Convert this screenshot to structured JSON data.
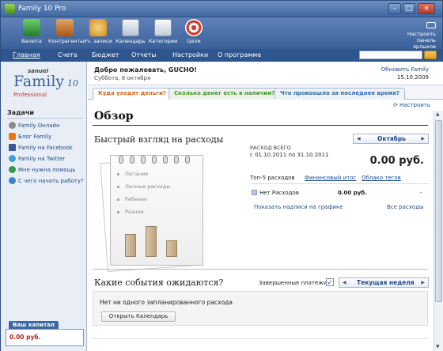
{
  "window": {
    "title": "Family 10 Pro"
  },
  "toolbar": {
    "items": [
      {
        "label": "Валюта",
        "icon": "currency-icon",
        "color": "#2e8b3a"
      },
      {
        "label": "Контрагенты",
        "icon": "contacts-bag-icon",
        "color": "#c47a2a"
      },
      {
        "label": "Уч. записи",
        "icon": "accounts-people-icon",
        "color": "#e0a030"
      },
      {
        "label": "Календарь",
        "icon": "calendar-icon",
        "color": "#cfd8e6"
      },
      {
        "label": "Категории",
        "icon": "categories-icon",
        "color": "#d9dfe8"
      },
      {
        "label": "Цели",
        "icon": "goals-target-icon",
        "color": "#d33b2c"
      }
    ],
    "customize": "Настроить панель ярлыков"
  },
  "menu": {
    "items": [
      "Главная",
      "Счета",
      "Бюджет",
      "Отчеты",
      "Настройки",
      "О программе"
    ],
    "active": "Главная"
  },
  "sidebar": {
    "logo": {
      "brand": "sanuel",
      "name": "Family",
      "version": "10",
      "edition": "Professional"
    },
    "tasks_title": "Задачи",
    "tasks": [
      {
        "label": "Family Онлайн",
        "icon": "globe-icon",
        "color": "#8a8a8a"
      },
      {
        "label": "Блог Family",
        "icon": "blog-icon",
        "color": "#e07820"
      },
      {
        "label": "Family на Facebook",
        "icon": "facebook-icon",
        "color": "#3b5998"
      },
      {
        "label": "Family на Twitter",
        "icon": "twitter-icon",
        "color": "#3aa0d8"
      },
      {
        "label": "Мне нужна помощь",
        "icon": "help-icon",
        "color": "#2e9a4a"
      },
      {
        "label": "С чего начать работу?",
        "icon": "info-icon",
        "color": "#3a86c8"
      }
    ],
    "capital": {
      "title": "Ваш капитал",
      "value": "0.00 руб."
    }
  },
  "greeting": {
    "hello": "Добро пожаловать, GUCHO!",
    "date": "Суббота, 8 октября",
    "update_link": "Обновить Family",
    "update_date": "15.10.2009"
  },
  "tabs": [
    {
      "label": "Куда уходят деньги?",
      "color": "#d8651a"
    },
    {
      "label": "Сколько денег есть в наличии?",
      "color": "#3a9a2a"
    },
    {
      "label": "Что произошло за последнее время?",
      "color": "#2a6cb0"
    }
  ],
  "content": {
    "settings_link": "Настроить",
    "overview_title": "Обзор",
    "quick_title": "Быстрый взгляд на расходы",
    "notepad": {
      "lines": [
        "Питание",
        "Личные расходы",
        "Ребенок",
        "Разное"
      ],
      "bars": [
        0.55,
        0.75,
        0.4
      ]
    },
    "month": "Октябрь",
    "period_label": "РАСХОД ВСЕГО",
    "period_range": "с 01.10.2011 по 31.10.2011",
    "total": "0.00 руб.",
    "top5_label": "Топ-5 расходов",
    "top5_links": [
      "Финансовый итог",
      "Облако тегов"
    ],
    "no_expenses": "Нет Расходов",
    "no_expenses_value": "0.00 руб.",
    "no_expenses_dash": "-",
    "show_labels_link": "Показать надписи на графике",
    "all_expenses_link": "Все расходы",
    "events_title": "Какие события ожидаются?",
    "done_payments_label": "Завершенные платежи",
    "done_payments_checked": "✓",
    "week": "Текущая неделя",
    "no_events_msg": "Нет ни одного запланированного расхода",
    "open_calendar": "Открыть Календарь"
  }
}
